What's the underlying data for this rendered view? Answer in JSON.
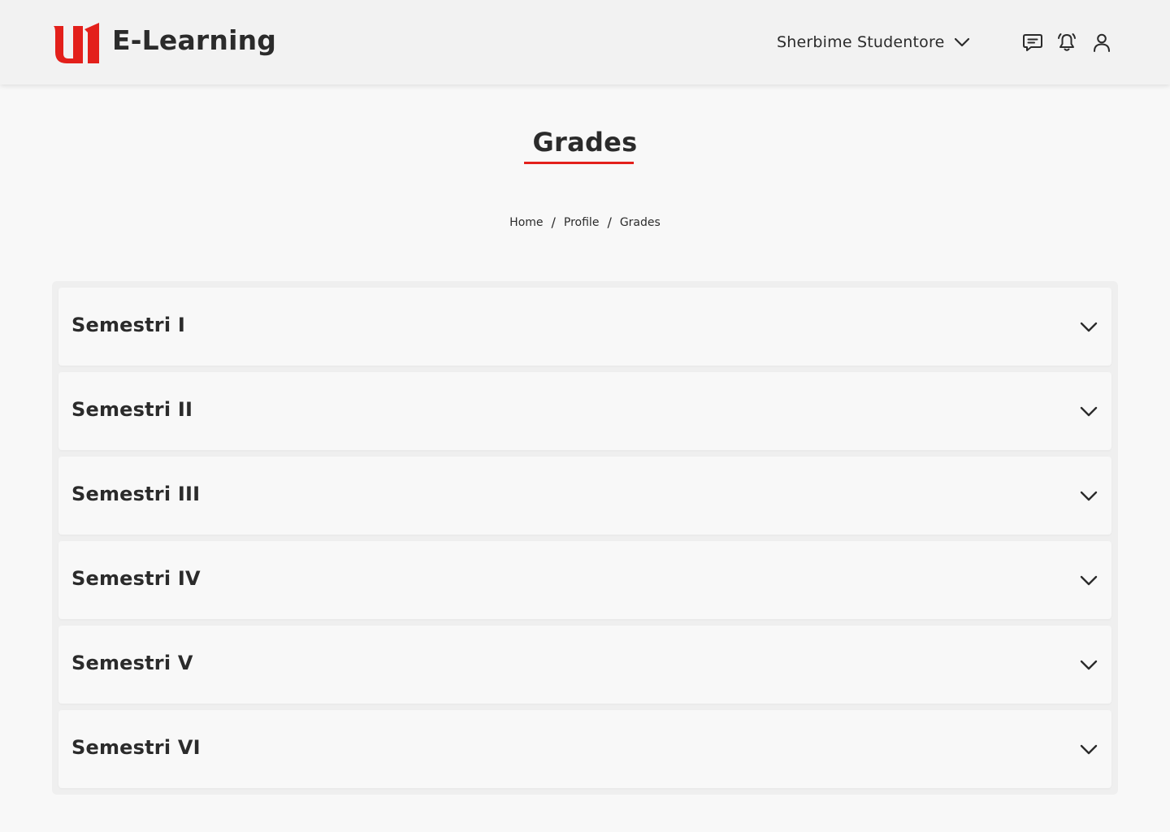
{
  "header": {
    "logo_text": "E-Learning",
    "menu_label": "Sherbime Studentore",
    "icons": [
      "chat-icon",
      "bell-icon",
      "user-icon"
    ]
  },
  "page": {
    "title": "Grades"
  },
  "breadcrumb": {
    "items": [
      "Home",
      "Profile",
      "Grades"
    ],
    "separator": "/"
  },
  "semesters": [
    {
      "label": "Semestri I"
    },
    {
      "label": "Semestri II"
    },
    {
      "label": "Semestri III"
    },
    {
      "label": "Semestri IV"
    },
    {
      "label": "Semestri V"
    },
    {
      "label": "Semestri VI"
    }
  ],
  "colors": {
    "accent": "#e3201b",
    "text": "#2b2b2b",
    "header_bg": "#f2f2f2",
    "page_bg": "#f8f8f8"
  }
}
